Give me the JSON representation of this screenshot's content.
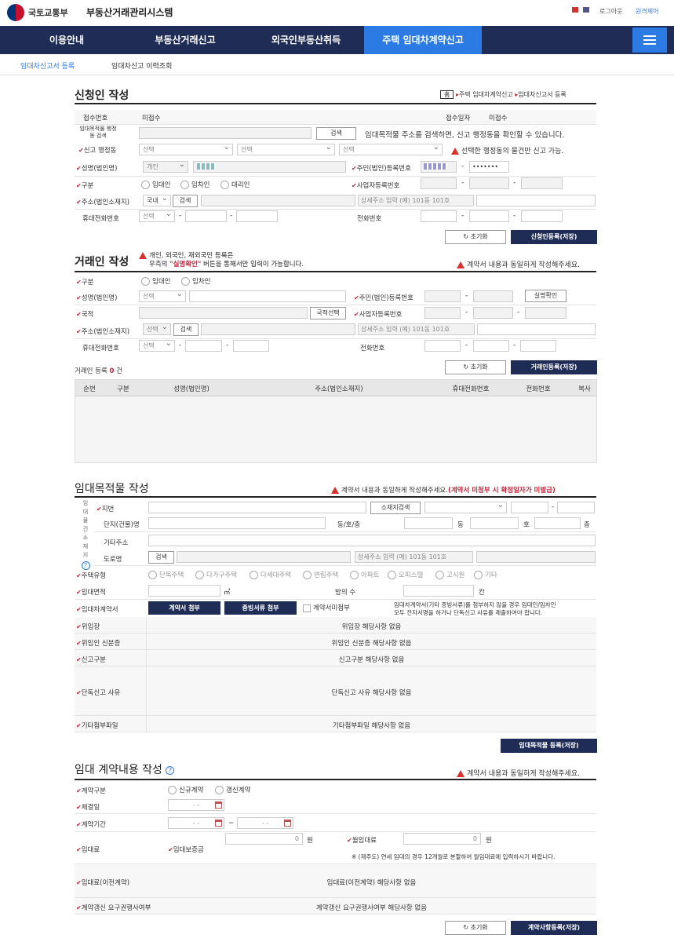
{
  "header": {
    "ministry": "국토교통부",
    "system": "부동산거래관리시스템",
    "logout": "로그아웃",
    "remote": "원격제어"
  },
  "nav": [
    "이용안내",
    "부동산거래신고",
    "외국인부동산취득",
    "주택 임대차계약신고"
  ],
  "subnav": [
    "임대차신고서 등록",
    "임대차신고 이력조회"
  ],
  "applicant": {
    "title": "신청인 작성",
    "breadcrumb": [
      "주택 임대차계약신고",
      "임대차신고서 등록"
    ],
    "home": "홈",
    "receipt_no_label": "접수번호",
    "receipt_no": "미접수",
    "receipt_date_label": "접수일자",
    "receipt_date": "미접수",
    "search_label": "임대목적물 행정동 검색",
    "search_btn": "검색",
    "search_note": "임대목적물 주소를 검색하면, 신고 행정동을 확인할 수 있습니다.",
    "dong_label": "신고 행정동",
    "select": "선택",
    "dong_note": "선택한 행정동의 물건만 신고 가능.",
    "name_label": "성명(법인명)",
    "name_type": "개인",
    "rrn_label": "주민(법인)등록번호",
    "rrn_back": "•••••••",
    "kind_label": "구분",
    "kinds": [
      "임대인",
      "임차인",
      "대리인"
    ],
    "biz_label": "사업자등록번호",
    "addr_label": "주소(법인소재지)",
    "addr_type": "국내",
    "addr_btn": "검색",
    "addr_detail_ph": "상세주소 입력 (예) 101동 101호",
    "mobile_label": "휴대전화번호",
    "phone_label": "전화번호",
    "reset": "초기화",
    "save": "신청인등록(저장)"
  },
  "party": {
    "title": "거래인 작성",
    "note1": "개인, 외국인, 재외국민 등록은",
    "note2a": "우측의 ",
    "note2b": "\"실명확인\"",
    "note2c": " 버튼을 통해서만 입력이 가능합니다.",
    "warn": "계약서 내용과 동일하게 작성해주세요.",
    "kind_label": "구분",
    "kinds": [
      "임대인",
      "임차인"
    ],
    "name_label": "성명(법인명)",
    "select": "선택",
    "rrn_label": "주민(법인)등록번호",
    "verify": "실명확인",
    "nation_label": "국적",
    "nation_btn": "국적선택",
    "biz_label": "사업자등록번호",
    "addr_label": "주소(법인소재지)",
    "addr_btn": "검색",
    "addr_detail_ph": "상세주소 입력 (예) 101동 101호",
    "mobile_label": "휴대전화번호",
    "phone_label": "전화번호",
    "count_prefix": "거래인 등록 ",
    "count": "0",
    "count_suffix": " 건",
    "reset": "초기화",
    "save": "거래인등록(저장)",
    "columns": [
      "순번",
      "구분",
      "성명(법인명)",
      "주소(법인소재지)",
      "휴대전화번호",
      "전화번호",
      "복사"
    ]
  },
  "property": {
    "title": "임대목적물 작성",
    "warn": "계약서 내용과 동일하게 작성해주세요.",
    "warn_red": "(계약서 미첨부 시 확정일자가 미발급)",
    "side": [
      "임",
      "대",
      "물",
      "건",
      "소",
      "재",
      "지"
    ],
    "lot_label": "지번",
    "addr_search": "소재지검색",
    "bldg_label": "단지(건물)명",
    "dong_ho_label": "동/호/층",
    "dong": "동",
    "ho": "호",
    "floor": "층",
    "etc_addr_label": "기타주소",
    "road_label": "도로명",
    "road_btn": "검색",
    "road_ph": "상세주소 입력 (예) 101동 101호",
    "type_label": "주택유형",
    "types": [
      "단독주택",
      "다가구주택",
      "다세대주택",
      "연립주택",
      "아파트",
      "오피스텔",
      "고시원",
      "기타"
    ],
    "area_label": "임대면적",
    "area_unit": "㎡",
    "rooms_label": "방의 수",
    "rooms_unit": "칸",
    "contract_label": "임대차계약서",
    "attach1": "계약서 첨부",
    "attach2": "증빙서류 첨부",
    "no_attach": "계약서미첨부",
    "attach_note1": "임대차계약서(기타 증빙서류)를 첨부하지 않을 경우 임대인/임차인",
    "attach_note2": "모두 전자서명을 하거나 단독신고 사유를 제출하여야 합니다.",
    "poa_label": "위임장",
    "poa_val": "위임장 해당사항 없음",
    "poa_id_label": "위임인 신분증",
    "poa_id_val": "위임인 신분증 해당사항 없음",
    "rep_label": "신고구분",
    "rep_val": "신고구분 해당사항 없음",
    "solo_label": "단독신고 사유",
    "solo_val": "단독신고 사유 해당사항 없음",
    "other_label": "기타첨부파일",
    "other_val": "기타첨부파일 해당사항 없음",
    "save": "임대목적물 등록(저장)"
  },
  "contract": {
    "title": "임대 계약내용 작성",
    "warn": "계약서 내용과 동일하게 작성해주세요.",
    "kind_label": "계약구분",
    "kinds": [
      "신규계약",
      "갱신계약"
    ],
    "sign_label": "체결일",
    "period_label": "계약기간",
    "date_ph": "-  -",
    "tilde": "~",
    "rent_label": "임대료",
    "deposit_label": "임대보증금",
    "monthly_label": "월임대료",
    "zero": "0",
    "won": "원",
    "jeju_note": "※ (제주도) 연세 임대의 경우 12개월로 분할하여 월임대료에 입력하시기 바랍니다.",
    "prev_label": "임대료(이전계약)",
    "prev_val": "임대료(이전계약) 해당사항 없음",
    "renew_label": "계약갱신 요구권행사여부",
    "renew_val": "계약갱신 요구권행사여부 해당사항 없음",
    "reset": "초기화",
    "save": "계약사항등록(저장)"
  }
}
